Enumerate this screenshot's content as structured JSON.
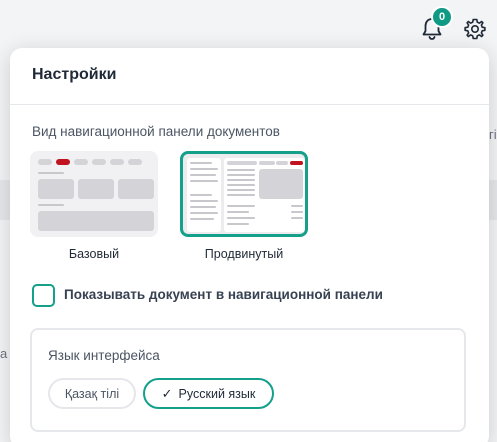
{
  "topbar": {
    "notifications_count": "0",
    "bell_icon": "bell-icon",
    "settings_icon": "gear-icon"
  },
  "background": {
    "right_fragment": "гі",
    "left_fragment": "а"
  },
  "settings": {
    "title": "Настройки",
    "nav_view_title": "Вид навигационной панели документов",
    "nav_options": [
      {
        "label": "Базовый",
        "selected": false
      },
      {
        "label": "Продвинутый",
        "selected": true
      }
    ],
    "show_in_nav_label": "Показывать документ в навигационной панели",
    "show_in_nav_checked": false,
    "language": {
      "title": "Язык интерфейса",
      "options": [
        {
          "label": "Қазақ тілі",
          "selected": false
        },
        {
          "label": "Русский язык",
          "selected": true
        }
      ]
    }
  },
  "colors": {
    "accent": "#15a08c",
    "badge": "#0f9a86",
    "highlight_red": "#c1121f"
  }
}
